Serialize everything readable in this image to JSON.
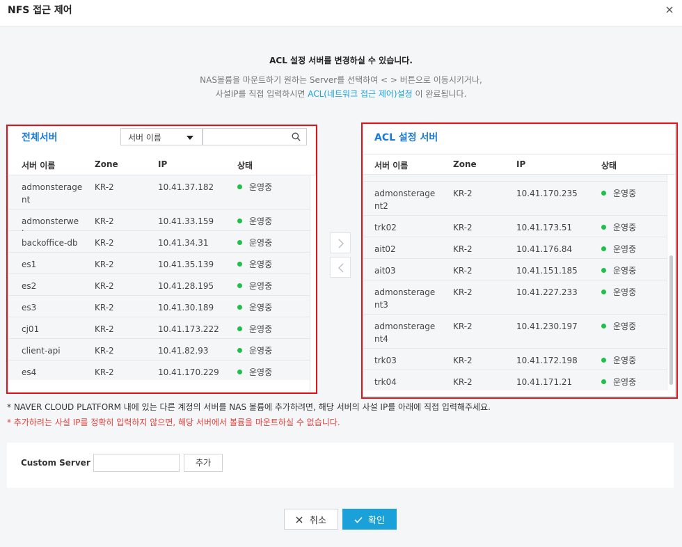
{
  "modal": {
    "title": "NFS 접근 제어"
  },
  "intro": {
    "title": "ACL 설정 서버를 변경하실 수 있습니다.",
    "line1": "NAS볼륨을 마운트하기 원하는 Server를 선택하여 < > 버튼으로 이동시키거나,",
    "line2_prefix": "사설IP를 직접 입력하시면 ",
    "line2_link": "ACL(네트워크 접근 제어)설정",
    "line2_suffix": " 이 완료됩니다."
  },
  "left_panel": {
    "title": "전체서버",
    "search_select": "서버 이름",
    "search_placeholder": "",
    "columns": [
      "서버 이름",
      "Zone",
      "IP",
      "상태"
    ],
    "rows": [
      {
        "name": "admonsteragent",
        "zone": "KR-2",
        "ip": "10.41.37.182",
        "status": "운영중"
      },
      {
        "name": "admonsterweb",
        "zone": "KR-2",
        "ip": "10.41.33.159",
        "status": "운영중"
      },
      {
        "name": "backoffice-db",
        "zone": "KR-2",
        "ip": "10.41.34.31",
        "status": "운영중"
      },
      {
        "name": "es1",
        "zone": "KR-2",
        "ip": "10.41.35.139",
        "status": "운영중"
      },
      {
        "name": "es2",
        "zone": "KR-2",
        "ip": "10.41.28.195",
        "status": "운영중"
      },
      {
        "name": "es3",
        "zone": "KR-2",
        "ip": "10.41.30.189",
        "status": "운영중"
      },
      {
        "name": "cj01",
        "zone": "KR-2",
        "ip": "10.41.173.222",
        "status": "운영중"
      },
      {
        "name": "client-api",
        "zone": "KR-2",
        "ip": "10.41.82.93",
        "status": "운영중"
      },
      {
        "name": "es4",
        "zone": "KR-2",
        "ip": "10.41.170.229",
        "status": "운영중"
      }
    ]
  },
  "right_panel": {
    "title": "ACL 설정 서버",
    "columns": [
      "서버 이름",
      "Zone",
      "IP",
      "상태"
    ],
    "rows": [
      {
        "name": "admonsteragent2",
        "zone": "KR-2",
        "ip": "10.41.170.235",
        "status": "운영중"
      },
      {
        "name": "trk02",
        "zone": "KR-2",
        "ip": "10.41.173.51",
        "status": "운영중"
      },
      {
        "name": "ait02",
        "zone": "KR-2",
        "ip": "10.41.176.84",
        "status": "운영중"
      },
      {
        "name": "ait03",
        "zone": "KR-2",
        "ip": "10.41.151.185",
        "status": "운영중"
      },
      {
        "name": "admonsteragent3",
        "zone": "KR-2",
        "ip": "10.41.227.233",
        "status": "운영중"
      },
      {
        "name": "admonsteragent4",
        "zone": "KR-2",
        "ip": "10.41.230.197",
        "status": "운영중"
      },
      {
        "name": "trk03",
        "zone": "KR-2",
        "ip": "10.41.172.198",
        "status": "운영중"
      },
      {
        "name": "trk04",
        "zone": "KR-2",
        "ip": "10.41.171.21",
        "status": "운영중"
      }
    ]
  },
  "move_buttons": {
    "right": "move-right",
    "left": "move-left"
  },
  "notes": {
    "info": "* NAVER CLOUD PLATFORM 내에 있는 다른 계정의 서버를 NAS 볼륨에 추가하려면, 해당 서버의 사설 IP를 아래에 직접 입력해주세요.",
    "warning": "* 추가하려는 사설 IP를 정확히 입력하지 않으면, 해당 서버에서 볼륨을 마운트하실 수 없습니다."
  },
  "custom": {
    "label": "Custom Server IP",
    "value": "",
    "add_label": "추가"
  },
  "footer": {
    "cancel_label": "취소",
    "confirm_label": "확인"
  },
  "colors": {
    "accent": "#1aa1d9",
    "title_blue": "#1a7ad4",
    "status_green": "#1ec04a",
    "warning_red": "#e8423c",
    "highlight_frame": "#e0121a"
  }
}
